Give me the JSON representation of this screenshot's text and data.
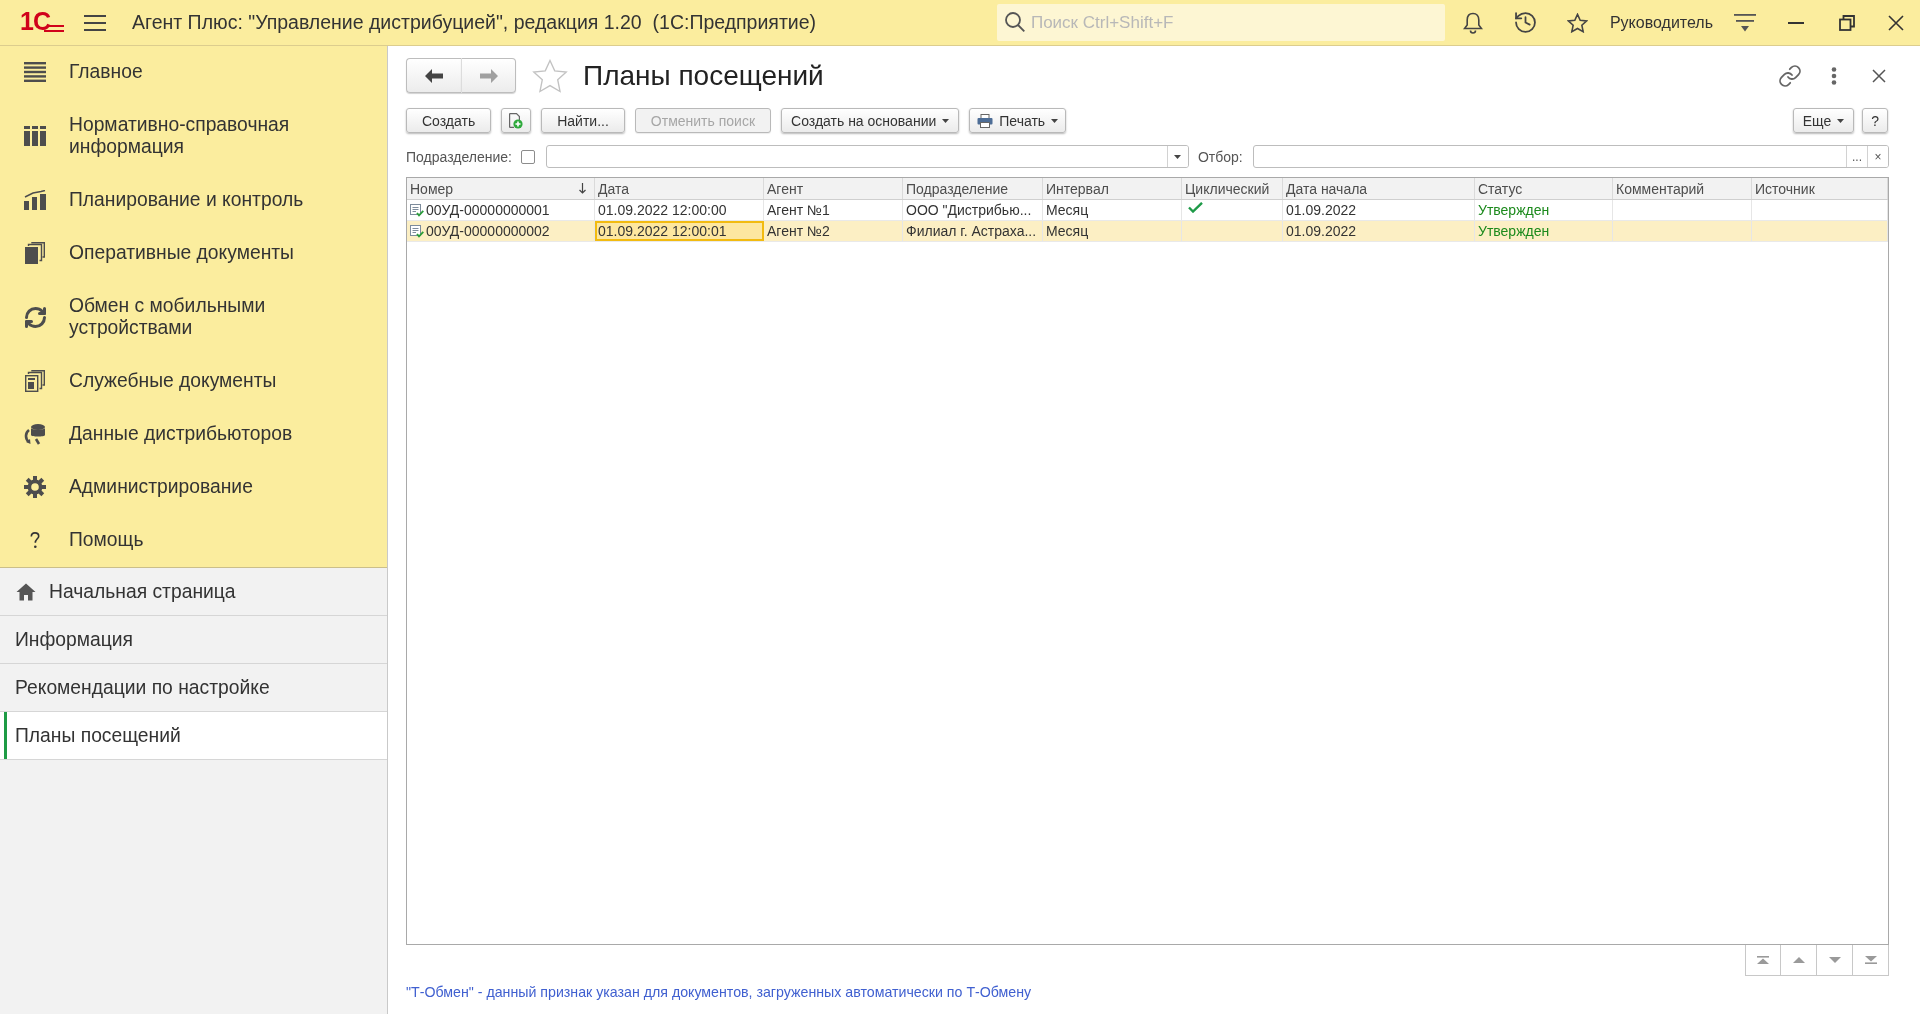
{
  "window": {
    "title": "Агент Плюс: \"Управление дистрибуцией\", редакция 1.20  (1С:Предприятие)"
  },
  "top_bar": {
    "logo": "1С",
    "search": {
      "placeholder": "Поиск Ctrl+Shift+F"
    },
    "user": "Руководитель"
  },
  "sections": [
    {
      "label": "Главное"
    },
    {
      "label": "Нормативно-справочная информация"
    },
    {
      "label": "Планирование и контроль"
    },
    {
      "label": "Оперативные документы"
    },
    {
      "label": "Обмен с мобильными устройствами"
    },
    {
      "label": "Служебные документы"
    },
    {
      "label": "Данные дистрибьюторов"
    },
    {
      "label": "Администрирование"
    },
    {
      "label": "Помощь"
    }
  ],
  "open_pages": [
    {
      "label": "Начальная страница",
      "kind": "home",
      "selected": false
    },
    {
      "label": "Информация",
      "kind": "page",
      "selected": false
    },
    {
      "label": "Рекомендации по настройке",
      "kind": "page",
      "selected": false
    },
    {
      "label": "Планы посещений",
      "kind": "page",
      "selected": true
    }
  ],
  "form": {
    "title": "Планы посещений",
    "favorite": false,
    "back_disabled": false,
    "forward_disabled": true
  },
  "toolbar": {
    "buttons": [
      {
        "kind": "plain",
        "label": "Создать",
        "disabled": false
      },
      {
        "kind": "add-icon",
        "disabled": false
      },
      {
        "kind": "plain",
        "label": "Найти...",
        "disabled": false
      },
      {
        "kind": "plain",
        "label": "Отменить поиск",
        "disabled": true
      },
      {
        "kind": "menu",
        "label": "Создать на основании",
        "disabled": false
      },
      {
        "kind": "print-menu",
        "label": "Печать",
        "disabled": false
      }
    ],
    "right_buttons": [
      {
        "kind": "menu",
        "label": "Еще",
        "disabled": false
      },
      {
        "kind": "plain",
        "label": "?",
        "disabled": false
      }
    ]
  },
  "filters": {
    "subdivision": {
      "label": "Подразделение:",
      "checked": false
    },
    "selection": {
      "label": "Отбор:",
      "choose_button": "...",
      "clear_button": "×"
    }
  },
  "table": {
    "columns": [
      {
        "label": "Номер",
        "sorted": true,
        "current": false
      },
      {
        "label": "Дата",
        "sorted": false,
        "current": true
      },
      {
        "label": "Агент",
        "sorted": false,
        "current": false
      },
      {
        "label": "Подразделение",
        "sorted": false,
        "current": false
      },
      {
        "label": "Интервал",
        "sorted": false,
        "current": false
      },
      {
        "label": "Циклический",
        "sorted": false,
        "current": false
      },
      {
        "label": "Дата начала",
        "sorted": false,
        "current": false
      },
      {
        "label": "Статус",
        "sorted": false,
        "current": false
      },
      {
        "label": "Комментарий",
        "sorted": false,
        "current": false
      },
      {
        "label": "Источник",
        "sorted": false,
        "current": false
      }
    ],
    "rows": [
      {
        "number": "00УД-00000000001",
        "date": "01.09.2022 12:00:00",
        "agent": "Агент №1",
        "subdivision": "ООО \"Дистрибью...",
        "interval": "Месяц",
        "cyclic": true,
        "start_date": "01.09.2022",
        "status": "Утвержден",
        "selected": false
      },
      {
        "number": "00УД-00000000002",
        "date": "01.09.2022 12:00:01",
        "agent": "Агент №2",
        "subdivision": "Филиал г. Астраха...",
        "interval": "Месяц",
        "cyclic": false,
        "start_date": "01.09.2022",
        "status": "Утвержден",
        "selected": true
      }
    ]
  },
  "note": "\"Т-Обмен\" - данный признак указан для документов, загруженных автоматически по Т-Обмену"
}
